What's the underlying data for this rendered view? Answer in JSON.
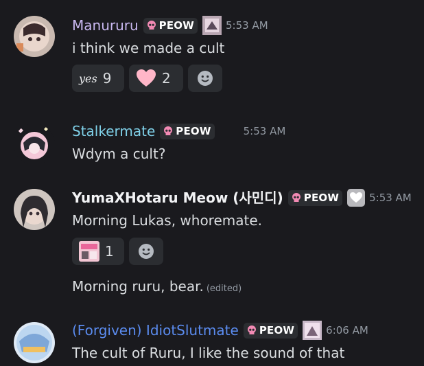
{
  "messages": [
    {
      "author": "Manururu",
      "author_color": "#c9b8f0",
      "tag": "PEOW",
      "time": "5:53 AM",
      "text": "i think we made a cult",
      "reactions": [
        {
          "emoji_text": "yes",
          "count": "9"
        },
        {
          "emoji_icon": "pink-heart-icon",
          "count": "2"
        }
      ]
    },
    {
      "author": "Stalkermate",
      "author_color": "#7fd0e8",
      "tag": "PEOW",
      "time": "5:53 AM",
      "text": "Wdym a cult?"
    },
    {
      "author": "YumaXHotaru Meow (사민디)",
      "author_color": "#f2f3f5",
      "tag": "PEOW",
      "time": "5:53 AM",
      "text": "Morning Lukas, whoremate.",
      "reactions": [
        {
          "emoji_icon": "peow-sticker-icon",
          "count": "1"
        }
      ],
      "followup_text": "Morning ruru, bear.",
      "followup_edited": "(edited)"
    },
    {
      "author": "(Forgiven) IdiotSlutmate",
      "author_color": "#5b8cf0",
      "tag": "PEOW",
      "time": "6:06 AM",
      "text": "The cult of Ruru, I like the sound of that"
    }
  ],
  "colors": {
    "background": "#1a1a1e",
    "pill": "#2b2d31",
    "timestamp": "#949ba4",
    "skull": "#f28ab4"
  }
}
